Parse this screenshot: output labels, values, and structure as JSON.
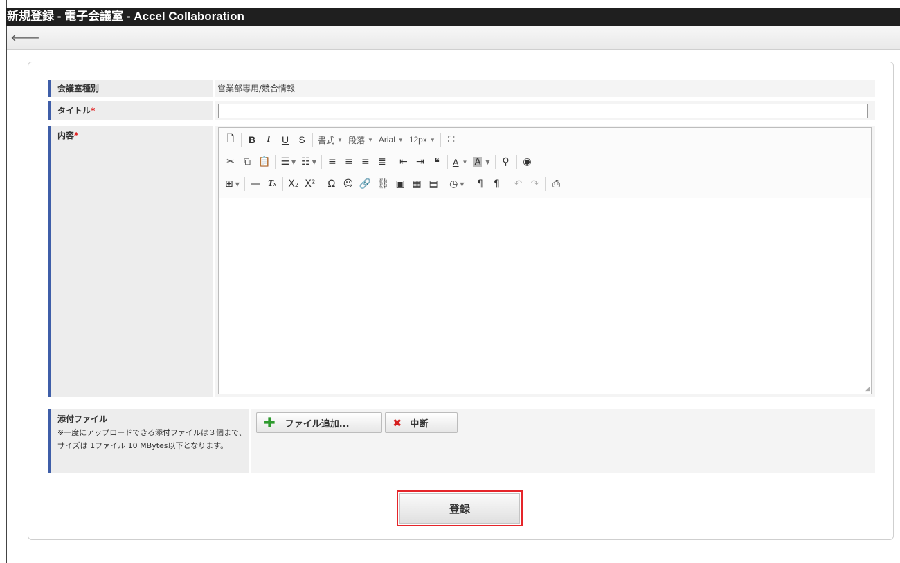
{
  "window": {
    "title": "新規登録 - 電子会議室 - Accel Collaboration"
  },
  "toolbar": {
    "back_icon": "arrow-left-icon",
    "back_glyph": "🡐"
  },
  "form": {
    "room_type": {
      "label": "会議室種別",
      "value": "営業部専用/競合情報"
    },
    "title": {
      "label": "タイトル",
      "required_mark": "*",
      "value": ""
    },
    "content": {
      "label": "内容",
      "required_mark": "*"
    },
    "attachment": {
      "label": "添付ファイル",
      "note": "※一度にアップロードできる添付ファイルは３個まで、サイズは 1ファイル 10 MBytes以下となります。",
      "add_button": "ファイル追加...",
      "abort_button": "中断"
    },
    "submit_button": "登録"
  },
  "editor": {
    "format_dropdown": "書式",
    "paragraph_dropdown": "段落",
    "font_dropdown": "Arial",
    "size_dropdown": "12px",
    "subscript": "X₂",
    "superscript": "X²"
  },
  "colors": {
    "accent_border": "#3f5ea8",
    "highlight": "#e5252a",
    "required": "#e02020"
  }
}
